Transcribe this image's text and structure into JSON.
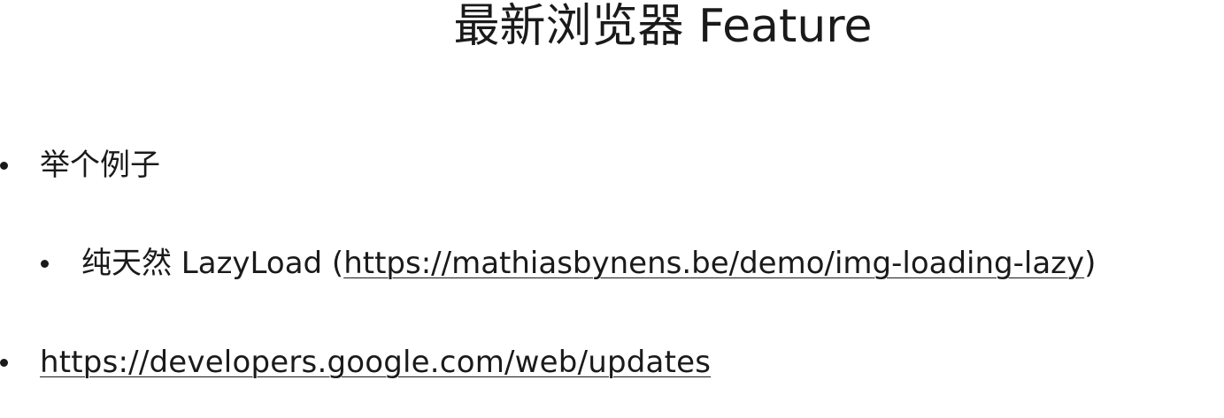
{
  "title": "最新浏览器 Feature",
  "bullets": {
    "example": {
      "text": "举个例子"
    },
    "lazyload": {
      "prefix": "纯天然 LazyLoad (",
      "link": "https://mathiasbynens.be/demo/img-loading-lazy",
      "suffix": ")"
    },
    "updates": {
      "link": "https://developers.google.com/web/updates"
    }
  }
}
